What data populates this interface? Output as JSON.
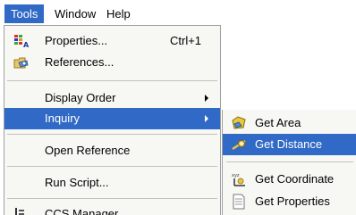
{
  "menubar": {
    "items": [
      {
        "label": "Tools"
      },
      {
        "label": "Window"
      },
      {
        "label": "Help"
      }
    ]
  },
  "tools_menu": {
    "items": [
      {
        "label": "Properties...",
        "shortcut": "Ctrl+1",
        "icon": "properties-icon"
      },
      {
        "label": "References...",
        "icon": "references-icon"
      },
      {
        "label": "Display Order",
        "has_submenu": true
      },
      {
        "label": "Inquiry",
        "has_submenu": true,
        "highlighted": true
      },
      {
        "label": "Open Reference"
      },
      {
        "label": "Run Script..."
      },
      {
        "label": "CCS Manager...",
        "icon": "ccs-manager-icon"
      }
    ]
  },
  "inquiry_submenu": {
    "items": [
      {
        "label": "Get Area",
        "icon": "get-area-icon"
      },
      {
        "label": "Get Distance",
        "icon": "get-distance-icon",
        "highlighted": true
      },
      {
        "label": "Get Coordinate",
        "icon": "get-coordinate-icon"
      },
      {
        "label": "Get Properties",
        "icon": "get-properties-icon"
      }
    ]
  },
  "colors": {
    "highlight": "#3169c6",
    "menu_background": "#f7f7f4",
    "separator": "#c5c2b8"
  }
}
